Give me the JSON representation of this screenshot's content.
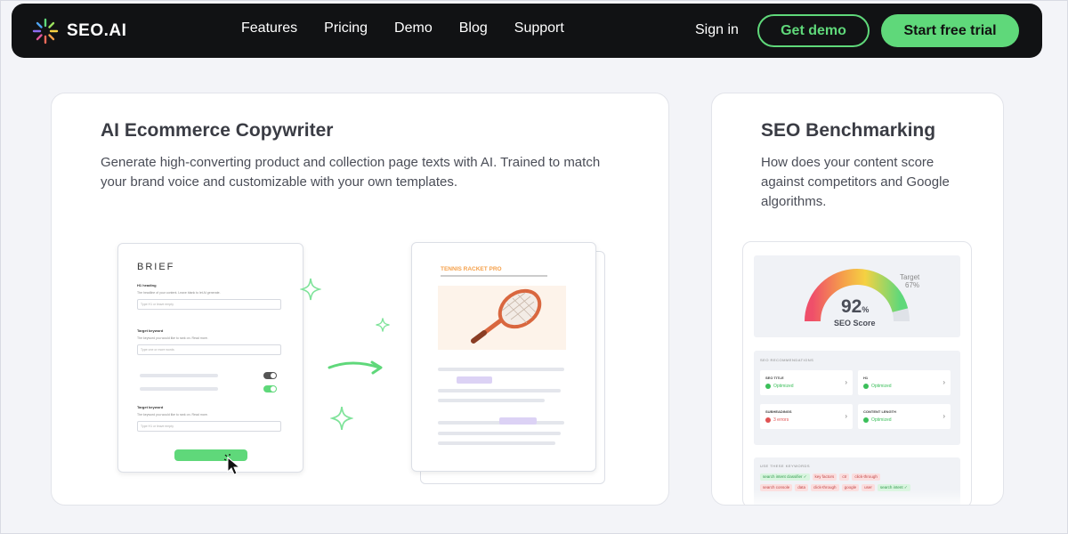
{
  "nav": {
    "logo_text": "SEO.AI",
    "links": [
      "Features",
      "Pricing",
      "Demo",
      "Blog",
      "Support"
    ],
    "signin": "Sign in",
    "get_demo": "Get demo",
    "start_trial": "Start free trial"
  },
  "copywriter": {
    "title": "AI Ecommerce Copywriter",
    "description": "Generate high-converting product and collection page texts with AI. Trained to match your brand voice and customizable with your own templates.",
    "brief": {
      "title": "BRIEF",
      "fields": [
        {
          "label": "H1 heading",
          "hint": "The headline of your content. Leave blank to let AI generate.",
          "placeholder": "Type H1 or leave empty"
        },
        {
          "label": "Target keyword",
          "hint": "The keyword you would like to rank on. Read more.",
          "placeholder": "Type one or more words"
        },
        {
          "label": "Target keyword",
          "hint": "The keyword you would like to rank on. Read more.",
          "placeholder": "Type H1 or leave empty"
        }
      ]
    },
    "product_page": {
      "title": "TENNIS RACKET PRO"
    }
  },
  "benchmark": {
    "title": "SEO Benchmarking",
    "description": "How does your content score against competitors and Google algorithms.",
    "gauge": {
      "score": "92",
      "unit": "%",
      "label": "SEO Score",
      "target_label": "Target",
      "target_value": "67%",
      "score_fraction": 0.92,
      "target_fraction": 0.67
    },
    "recs_heading": "SEO RECOMMENDATIONS",
    "recs": [
      {
        "name": "SEO TITLE",
        "status": "Optimized",
        "state": "ok"
      },
      {
        "name": "H1",
        "status": "Optimized",
        "state": "ok"
      },
      {
        "name": "SUBHEADINGS",
        "status": "3 errors",
        "state": "err"
      },
      {
        "name": "CONTENT LENGTH",
        "status": "Optimized",
        "state": "ok"
      }
    ],
    "keywords_heading": "USE THESE KEYWORDS",
    "keywords_row1": [
      {
        "text": "search intent classifier ✓",
        "state": "g"
      },
      {
        "text": "key factors",
        "state": "r"
      },
      {
        "text": "ctr",
        "state": "r"
      },
      {
        "text": "click-through",
        "state": "r"
      }
    ],
    "keywords_row2": [
      {
        "text": "search console",
        "state": "r"
      },
      {
        "text": "data",
        "state": "r"
      },
      {
        "text": "click-through",
        "state": "r"
      },
      {
        "text": "google",
        "state": "r"
      },
      {
        "text": "user",
        "state": "r"
      },
      {
        "text": "search intent ✓",
        "state": "g"
      }
    ]
  },
  "colors": {
    "nav_bg": "#111214",
    "accent_green": "#5fd87a",
    "page_bg": "#f3f4f8"
  }
}
